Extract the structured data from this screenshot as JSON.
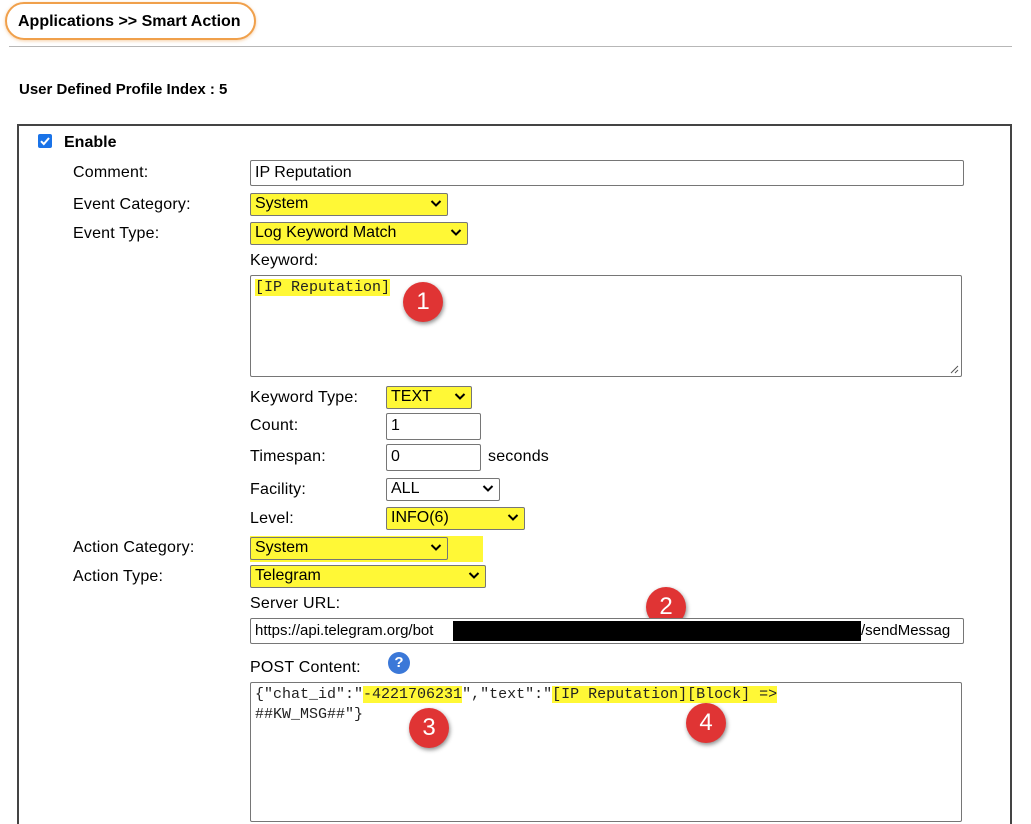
{
  "breadcrumb": "Applications >> Smart Action",
  "profile_label": "User Defined Profile Index : 5",
  "enable_label": "Enable",
  "enable_checked": true,
  "labels": {
    "comment": "Comment:",
    "event_category": "Event Category:",
    "event_type": "Event Type:",
    "keyword": "Keyword:",
    "keyword_type": "Keyword Type:",
    "count": "Count:",
    "timespan": "Timespan:",
    "seconds": "seconds",
    "facility": "Facility:",
    "level": "Level:",
    "action_category": "Action Category:",
    "action_type": "Action Type:",
    "server_url": "Server URL:",
    "post_content": "POST Content:"
  },
  "values": {
    "comment": "IP Reputation",
    "event_category": "System",
    "event_type": "Log Keyword Match",
    "keyword": "[IP Reputation]",
    "keyword_type": "TEXT",
    "count": "1",
    "timespan": "0",
    "facility": "ALL",
    "level": "INFO(6)",
    "action_category": "System",
    "action_type": "Telegram",
    "server_url_prefix": "https://api.telegram.org/bot",
    "server_url_suffix": "/sendMessag",
    "post_part1": "{\"chat_id\":\"",
    "post_chat_id": "-4221706231",
    "post_part2": "\",\"text\":\"",
    "post_text": "[IP Reputation][Block] =>",
    "post_line2": "##KW_MSG##\"}"
  },
  "badges": [
    "1",
    "2",
    "3",
    "4"
  ],
  "help_icon": "?",
  "colors": {
    "highlight": "#fff836",
    "badge": "#e03434",
    "checkbox": "#1a73e8",
    "crumb_border": "#f0a04b"
  }
}
